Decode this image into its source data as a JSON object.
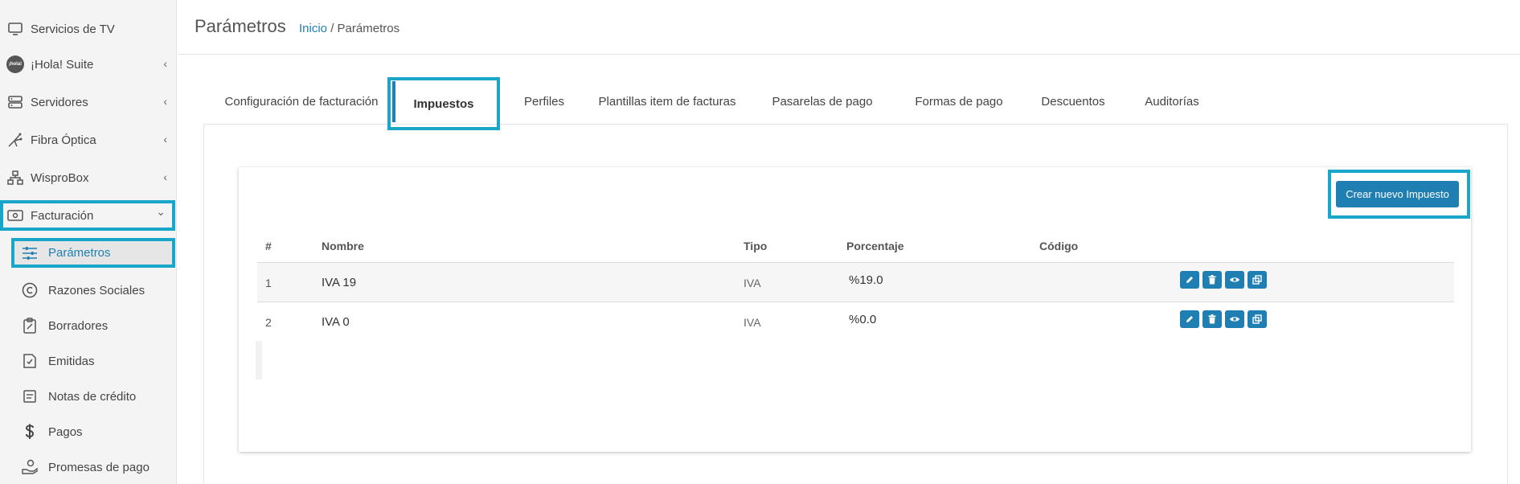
{
  "sidebar": {
    "items": [
      {
        "label": "Servicios de TV",
        "icon": "tv-icon",
        "chevron": false
      },
      {
        "label": "¡Hola! Suite",
        "icon": "hola-logo-icon",
        "chevron": true
      },
      {
        "label": "Servidores",
        "icon": "server-icon",
        "chevron": true
      },
      {
        "label": "Fibra Óptica",
        "icon": "fiber-icon",
        "chevron": true
      },
      {
        "label": "WisproBox",
        "icon": "network-icon",
        "chevron": true
      },
      {
        "label": "Facturación",
        "icon": "billing-icon",
        "chevron": true,
        "expanded": true
      }
    ],
    "hola_badge": "¡hola!",
    "chevron_left": "‹",
    "chevron_down": "⌄",
    "sub_items": [
      {
        "label": "Parámetros",
        "icon": "sliders-icon",
        "active": true
      },
      {
        "label": "Razones Sociales",
        "icon": "copyright-icon"
      },
      {
        "label": "Borradores",
        "icon": "clipboard-icon"
      },
      {
        "label": "Emitidas",
        "icon": "invoice-icon"
      },
      {
        "label": "Notas de crédito",
        "icon": "note-icon"
      },
      {
        "label": "Pagos",
        "icon": "dollar-icon"
      },
      {
        "label": "Promesas de pago",
        "icon": "hand-coin-icon"
      }
    ]
  },
  "header": {
    "title": "Parámetros",
    "breadcrumb_home": "Inicio",
    "breadcrumb_sep": " / ",
    "breadcrumb_current": "Parámetros"
  },
  "tabs": [
    "Configuración de facturación",
    "Impuestos",
    "Perfiles",
    "Plantillas item de facturas",
    "Pasarelas de pago",
    "Formas de pago",
    "Descuentos",
    "Auditorías"
  ],
  "create_button": "Crear nuevo Impuesto",
  "table": {
    "columns": [
      "#",
      "Nombre",
      "Tipo",
      "Porcentaje",
      "Código"
    ],
    "rows": [
      {
        "num": "1",
        "nombre": "IVA 19",
        "tipo": "IVA",
        "porcentaje": "%19.0",
        "codigo": ""
      },
      {
        "num": "2",
        "nombre": "IVA 0",
        "tipo": "IVA",
        "porcentaje": "%0.0",
        "codigo": ""
      }
    ],
    "row_actions": [
      "edit-icon",
      "trash-icon",
      "eye-icon",
      "copy-icon"
    ]
  },
  "colors": {
    "accent": "#1f7fb3",
    "highlight": "#1aa6c9"
  }
}
